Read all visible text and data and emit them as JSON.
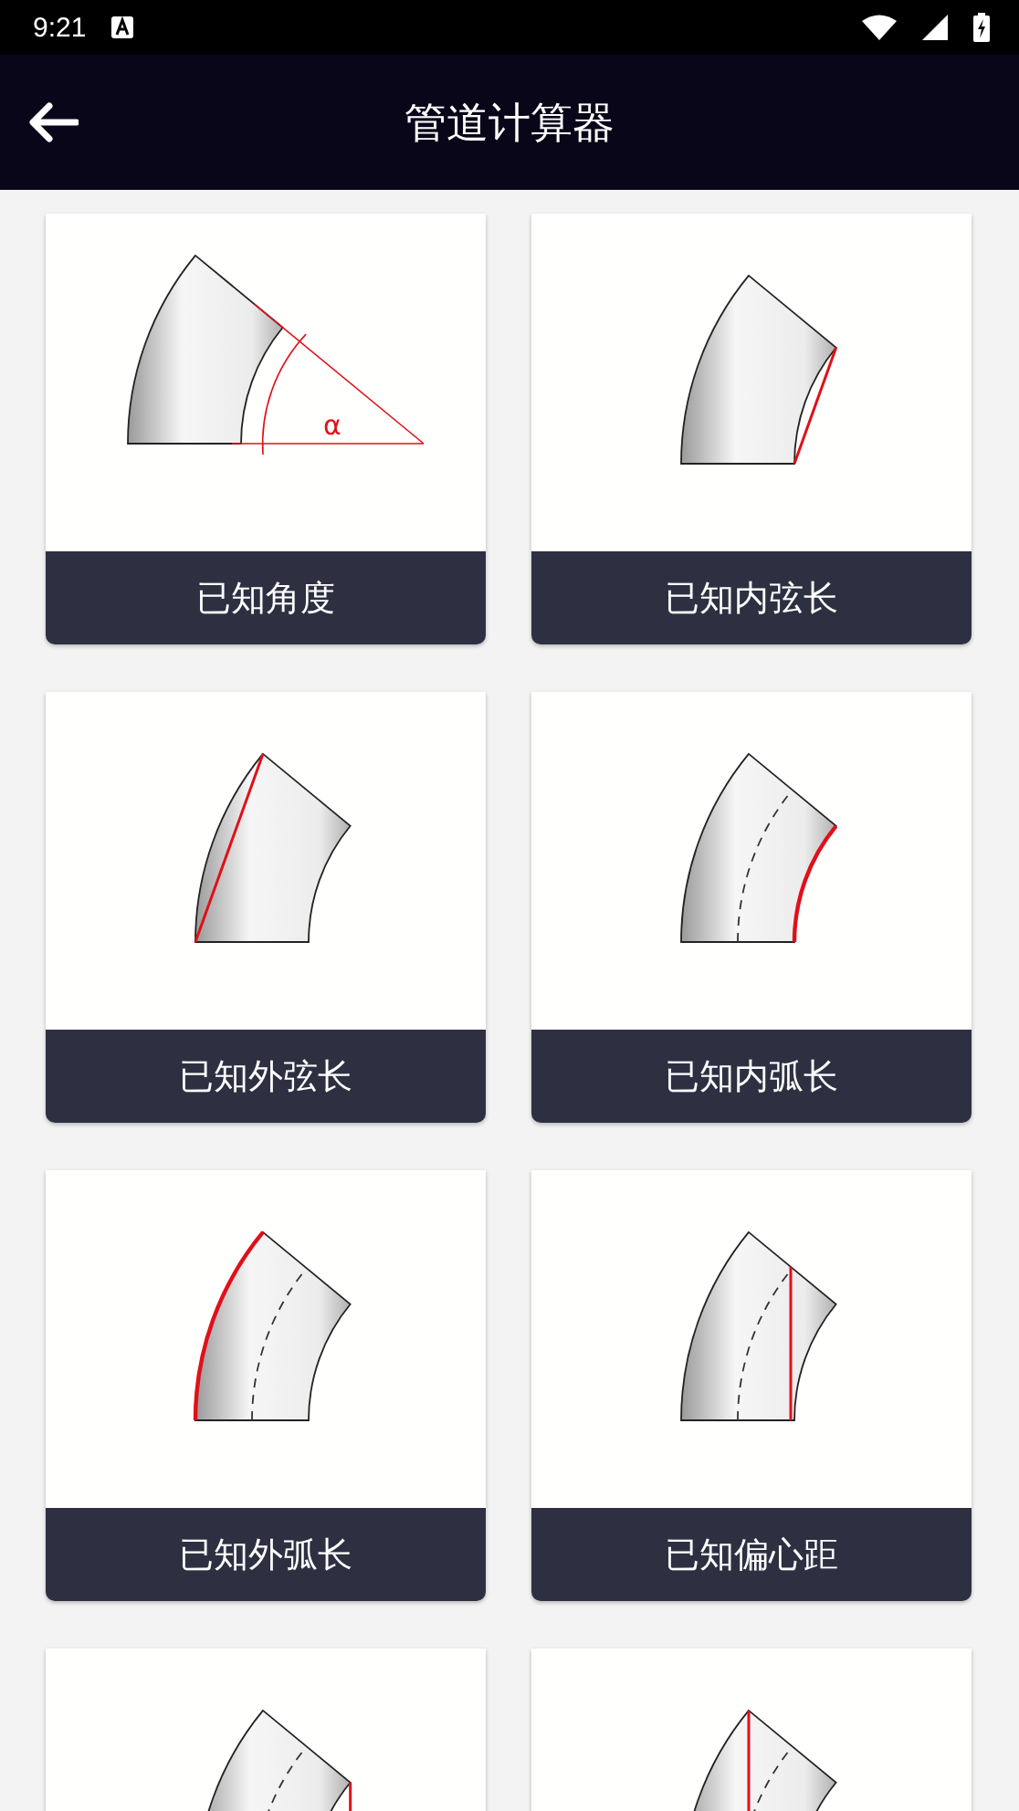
{
  "status_bar": {
    "time": "9:21"
  },
  "app_bar": {
    "title": "管道计算器"
  },
  "cards": [
    {
      "kind": "angle",
      "label": "已知角度",
      "symbol": "α"
    },
    {
      "kind": "inner_chord",
      "label": "已知内弦长"
    },
    {
      "kind": "outer_chord",
      "label": "已知外弦长"
    },
    {
      "kind": "inner_arc",
      "label": "已知内弧长"
    },
    {
      "kind": "outer_arc",
      "label": "已知外弧长"
    },
    {
      "kind": "eccentric",
      "label": "已知偏心距"
    },
    {
      "kind": "inner_vertical"
    },
    {
      "kind": "outer_vertical"
    }
  ]
}
